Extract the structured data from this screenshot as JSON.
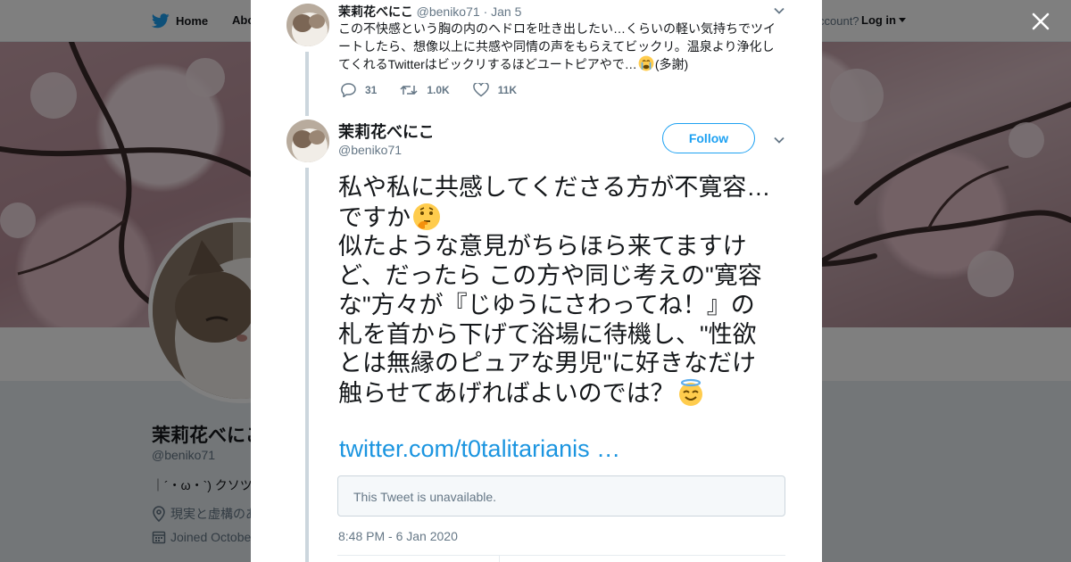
{
  "nav": {
    "home_label": "Home",
    "about_label": "Abo",
    "account_prompt": "ccount?",
    "login_label": "Log in"
  },
  "background_profile": {
    "name": "茉莉花べにこ",
    "handle": "@beniko71",
    "bio": "｜´・ω・`) クソツ",
    "location": "現実と虚構のあ",
    "joined": "Joined Octobe"
  },
  "reply_tweet": {
    "name": "茉莉花べにこ",
    "handle": "@beniko71",
    "separator": "·",
    "date": "Jan 5",
    "text_before_emoji": "この不快感という胸の内のヘドロを吐き出したい…くらいの軽い気持ちでツイートしたら、想像以上に共感や同情の声をもらえてビックリ。温泉より浄化してくれるTwitterはビックリするほどユートピアやで…",
    "text_after_emoji": "(多謝)",
    "reply_count": "31",
    "retweet_count": "1.0K",
    "like_count": "11K"
  },
  "main_tweet": {
    "name": "茉莉花べにこ",
    "handle": "@beniko71",
    "follow_label": "Follow",
    "lines": [
      "私や私に共感してくださる方が不寛容…",
      "ですか",
      "似たような意見がちらほら来てますけ",
      "ど、だったら この方や同じ考えの\"寛容",
      "な\"方々が『じゆうにさわってね！』の",
      "札を首から下げて浴場に待機し、\"性欲",
      "とは無縁のピュアな男児\"に好きなだけ",
      "触らせてあげればよいのでは？"
    ],
    "link": "twitter.com/t0talitarianis …",
    "unavailable": "This Tweet is unavailable.",
    "timestamp": "8:48 PM - 6 Jan 2020"
  },
  "icons": {
    "emoji_1": "crying-face-emoji",
    "emoji_2": "thinking-face-emoji",
    "emoji_3": "smiling-face-with-halo-emoji"
  },
  "colors": {
    "twitter_blue": "#1da1f2",
    "link_blue": "#1b95e0",
    "text": "#14171a",
    "muted": "#657786",
    "thread_line": "#ccd6dd"
  }
}
